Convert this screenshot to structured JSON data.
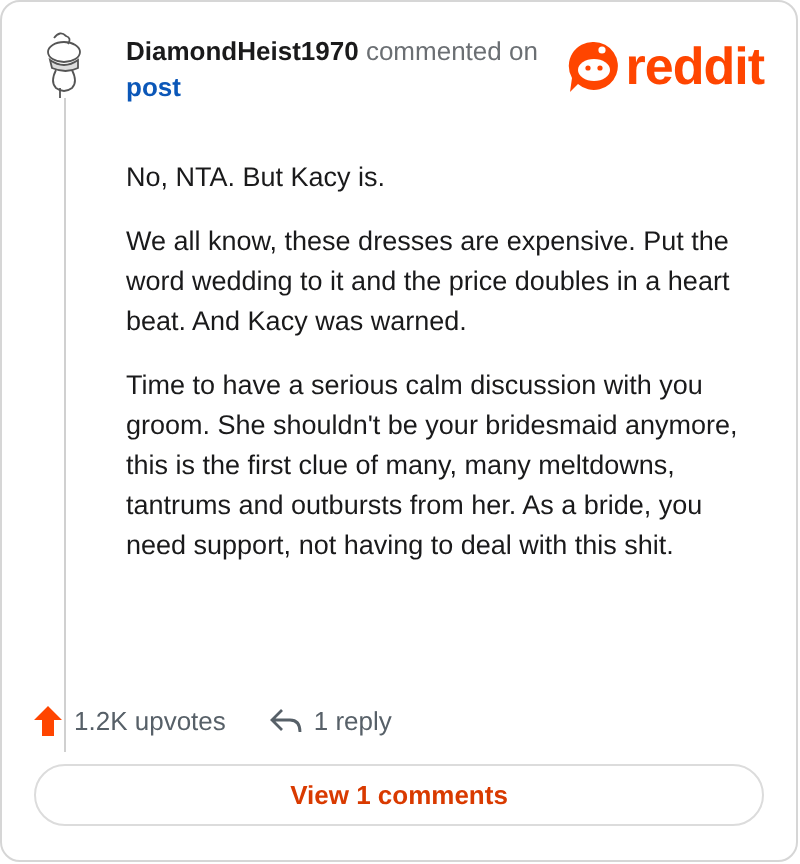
{
  "comment": {
    "author": "DiamondHeist1970",
    "action": "commented on",
    "target": "post",
    "logo": "reddit",
    "paragraphs": [
      "No, NTA. But Kacy is.",
      "We all know, these dresses are expensive. Put the word wedding to it and the price doubles in a heart beat. And Kacy was warned.",
      "Time to have a serious calm discussion with you groom. She shouldn't be your bridesmaid anymore, this is the first clue of many, many meltdowns, tantrums and outbursts from her. As a bride, you need support, not having to deal with this shit."
    ],
    "upvotes": "1.2K upvotes",
    "replies": "1 reply"
  },
  "view_button": "View 1 comments"
}
